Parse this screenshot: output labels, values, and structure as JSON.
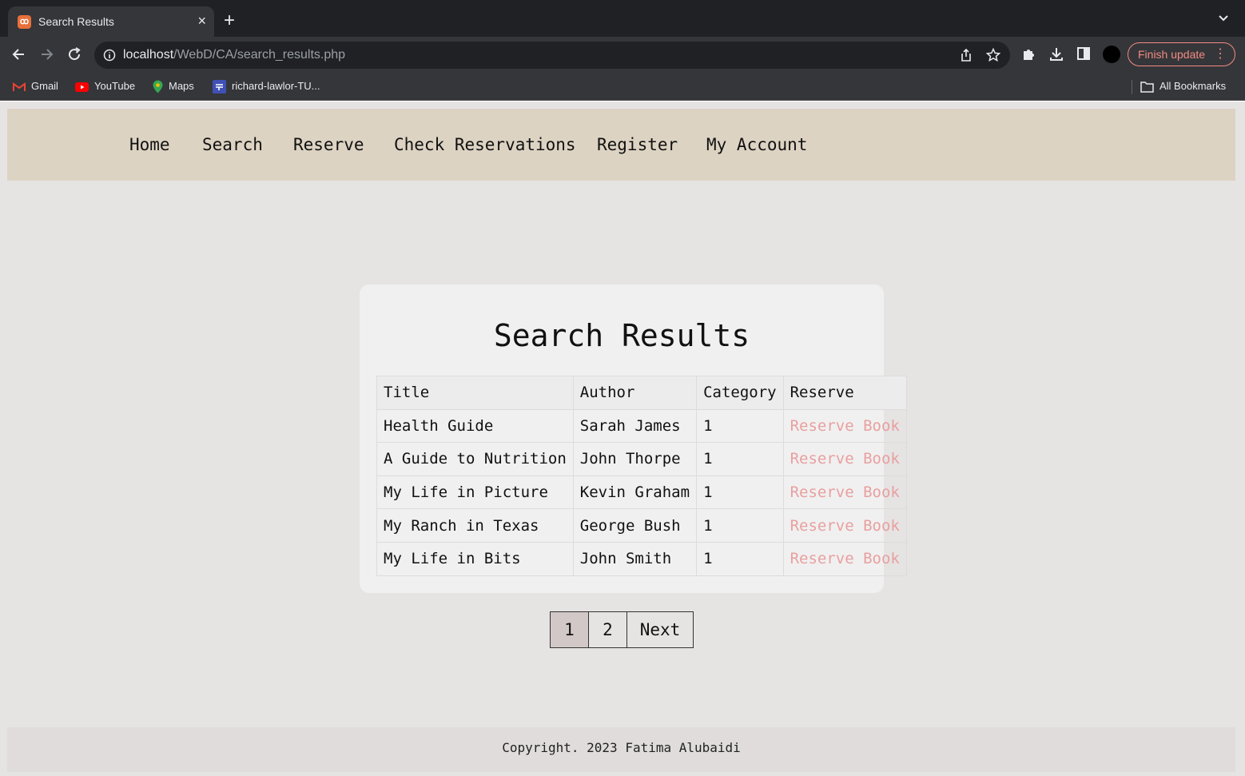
{
  "browser": {
    "tab_title": "Search Results",
    "url_host": "localhost",
    "url_path": "/WebD/CA/search_results.php",
    "finish_update_label": "Finish update",
    "bookmarks": [
      "Gmail",
      "YouTube",
      "Maps",
      "richard-lawlor-TU..."
    ],
    "all_bookmarks_label": "All Bookmarks"
  },
  "nav": {
    "items": [
      "Home",
      "Search",
      "Reserve",
      "Check Reservations",
      "Register",
      "My Account"
    ]
  },
  "results": {
    "title": "Search Results",
    "headers": [
      "Title",
      "Author",
      "Category",
      "Reserve"
    ],
    "rows": [
      {
        "title": "Health Guide",
        "author": "Sarah James",
        "category": "1",
        "action": "Reserve Book"
      },
      {
        "title": "A Guide to Nutrition",
        "author": "John Thorpe",
        "category": "1",
        "action": "Reserve Book"
      },
      {
        "title": "My Life in Picture",
        "author": "Kevin Graham",
        "category": "1",
        "action": "Reserve Book"
      },
      {
        "title": "My Ranch in Texas",
        "author": "George Bush",
        "category": "1",
        "action": "Reserve Book"
      },
      {
        "title": "My Life in Bits",
        "author": "John Smith",
        "category": "1",
        "action": "Reserve Book"
      }
    ]
  },
  "pagination": {
    "pages": [
      "1",
      "2"
    ],
    "current": "1",
    "next_label": "Next"
  },
  "footer": {
    "copyright": "Copyright. 2023 Fatima Alubaidi"
  },
  "colors": {
    "nav_bg": "#ddd3c3",
    "page_bg": "#e6e3e3",
    "reserve_link": "#e8a0a0",
    "active_page": "#d2c8c8"
  }
}
